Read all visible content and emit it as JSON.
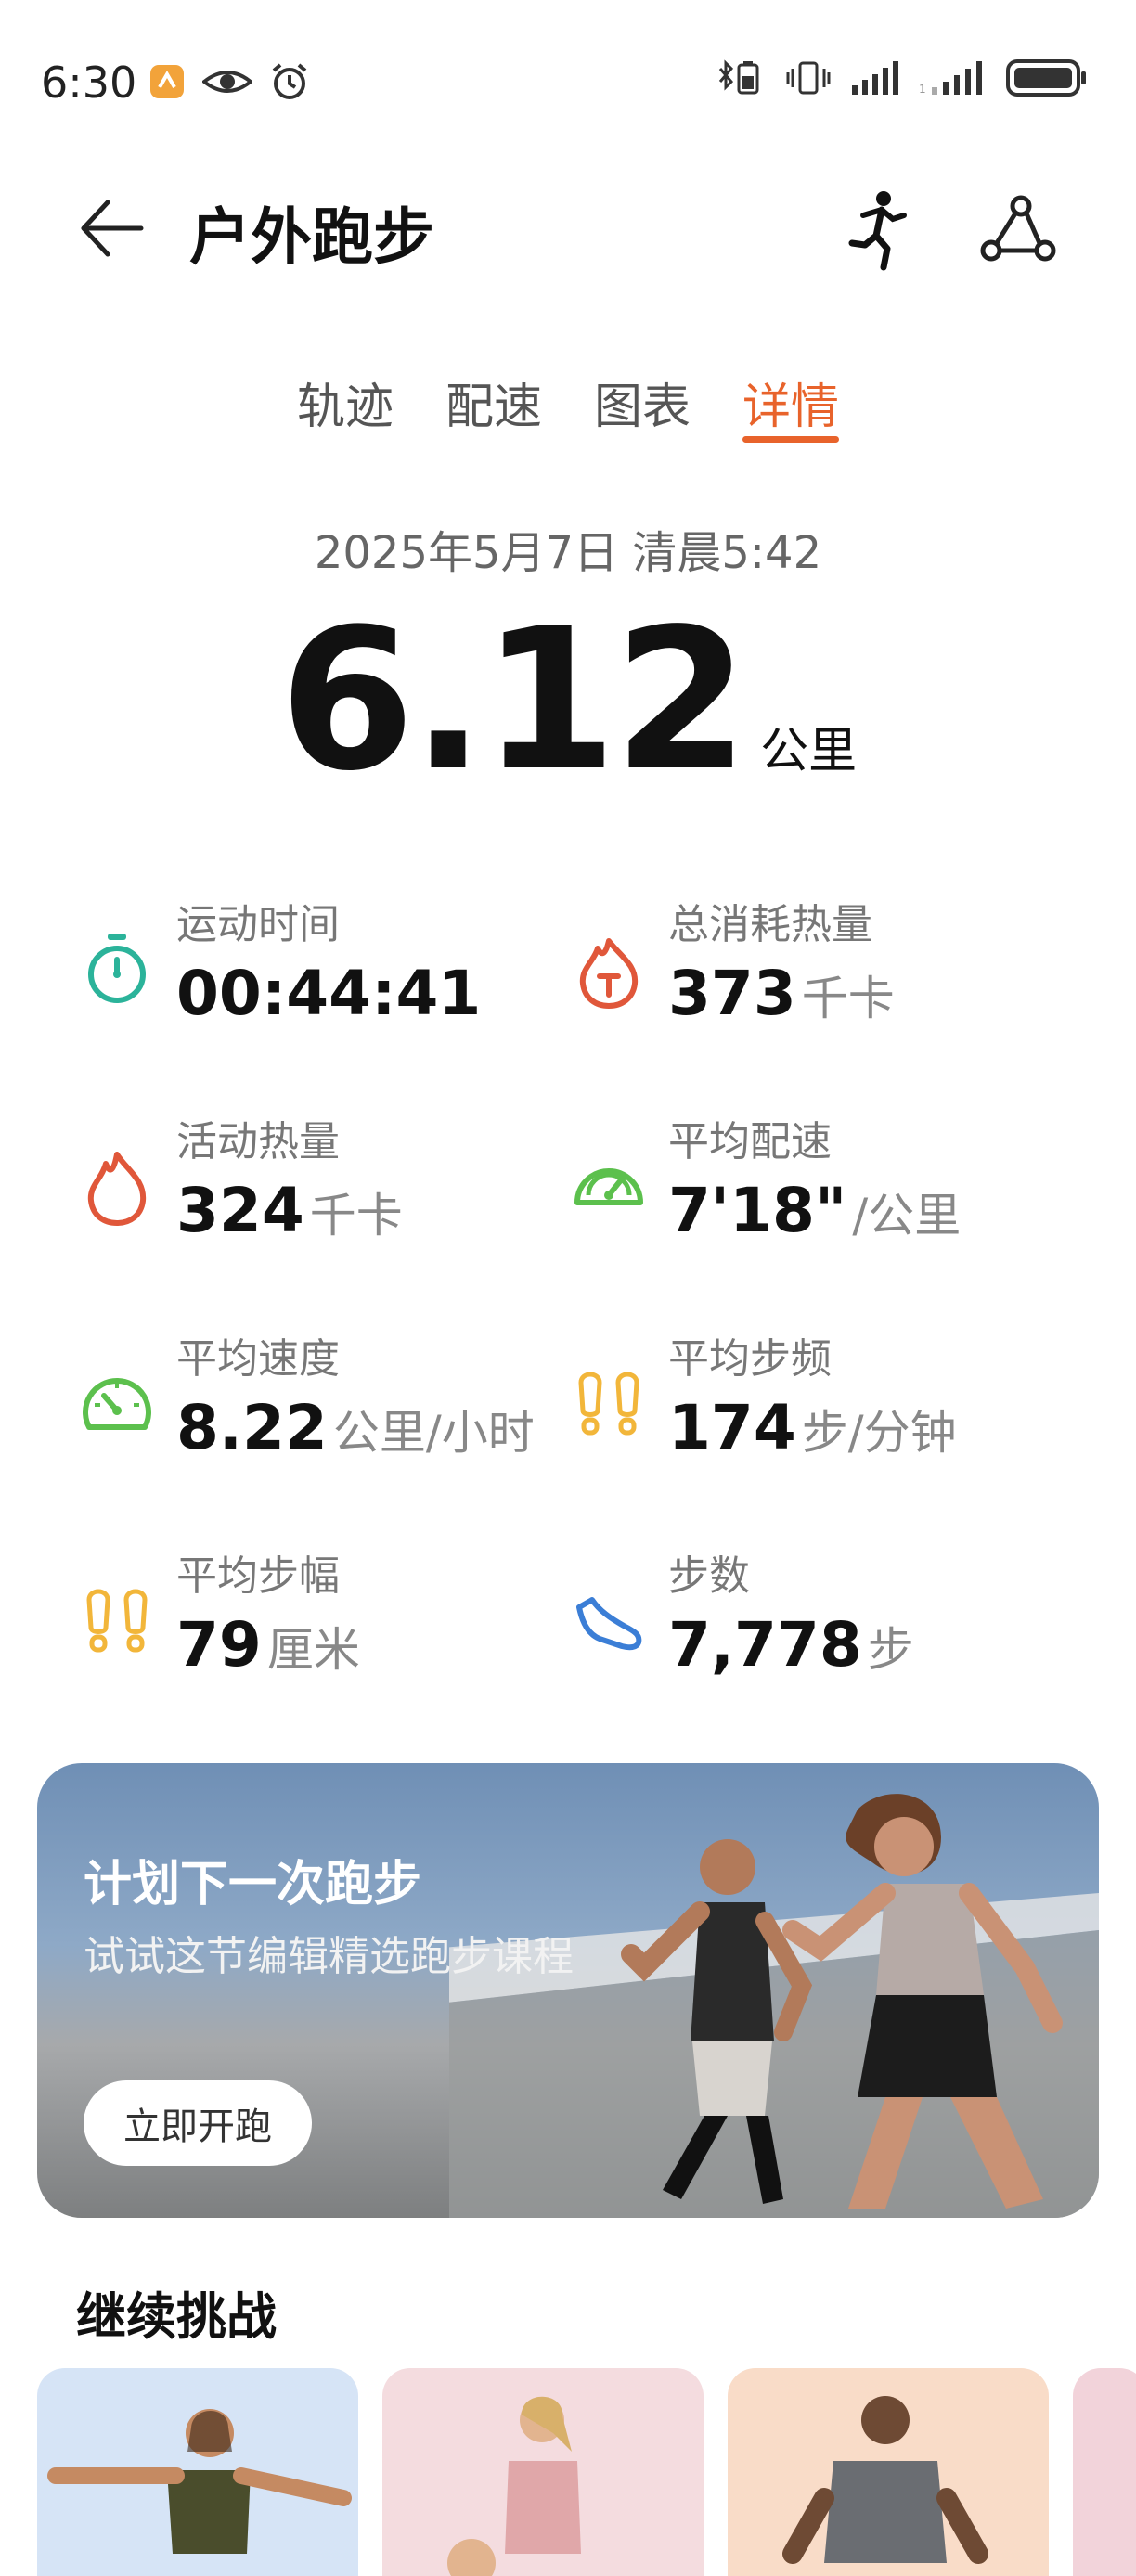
{
  "status_bar": {
    "time": "6:30",
    "icons_left": [
      "app-badge-icon",
      "eye-icon",
      "alarm-icon"
    ],
    "icons_right": [
      "bluetooth-battery-icon",
      "vibrate-icon",
      "signal-icon",
      "signal-2-icon",
      "battery-icon"
    ]
  },
  "header": {
    "title": "户外跑步",
    "back_icon": "back-arrow-icon",
    "right_icons": [
      "runner-icon",
      "route-icon"
    ]
  },
  "tabs": [
    {
      "label": "轨迹",
      "active": false
    },
    {
      "label": "配速",
      "active": false
    },
    {
      "label": "图表",
      "active": false
    },
    {
      "label": "详情",
      "active": true
    }
  ],
  "summary": {
    "datetime": "2025年5月7日 清晨5:42",
    "distance": "6.12",
    "distance_unit": "公里"
  },
  "stats": [
    {
      "label": "运动时间",
      "value": "00:44:41",
      "unit": "",
      "icon": "stopwatch-icon"
    },
    {
      "label": "总消耗热量",
      "value": "373",
      "unit": "千卡",
      "icon": "calorie-flame-icon"
    },
    {
      "label": "活动热量",
      "value": "324",
      "unit": "千卡",
      "icon": "flame-icon"
    },
    {
      "label": "平均配速",
      "value": "7'18\"",
      "unit": "/公里",
      "icon": "speedometer-icon"
    },
    {
      "label": "平均速度",
      "value": "8.22",
      "unit": "公里/小时",
      "icon": "gauge-icon"
    },
    {
      "label": "平均步频",
      "value": "174",
      "unit": "步/分钟",
      "icon": "footprints-icon"
    },
    {
      "label": "平均步幅",
      "value": "79",
      "unit": "厘米",
      "icon": "footprints-2-icon"
    },
    {
      "label": "步数",
      "value": "7,778",
      "unit": "步",
      "icon": "shoe-icon"
    }
  ],
  "banner": {
    "title": "计划下一次跑步",
    "subtitle": "试试这节编辑精选跑步课程",
    "button": "立即开跑"
  },
  "challenge": {
    "title": "继续挑战"
  },
  "colors": {
    "accent": "#e8632b",
    "teal": "#2bb39a",
    "red": "#e0573a",
    "green": "#5cc04d",
    "yellow": "#f2b63a",
    "blue": "#3b7ed6"
  }
}
